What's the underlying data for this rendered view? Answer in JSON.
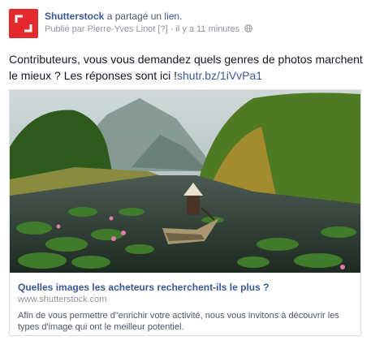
{
  "page": {
    "name": "Shutterstock",
    "action_text": " a partagé un ",
    "story_link": "lien",
    "story_suffix": "."
  },
  "meta": {
    "prefix": "Publié par ",
    "author": "Pierre-Yves Linot",
    "author_badge": " [?] ",
    "separator": "· ",
    "time": "il y a 11 minutes",
    "audience_icon": "globe-icon"
  },
  "message": {
    "text": "Contributeurs, vous vous demandez quels genres de photos marchent le mieux ? Les réponses sont ici !",
    "link": "shutr.bz/1iVvPa1"
  },
  "card": {
    "image_subject": "landscape-photo",
    "title": "Quelles images les acheteurs recherchent-ils le plus ?",
    "domain": "www.shutterstock.com",
    "description": "Afin de vous permettre d\"enrichir votre activité, nous vous invitons à découvrir les types d'image qui ont le meilleur potentiel."
  },
  "colors": {
    "brand_red": "#e42a2e",
    "link_blue": "#3b5998",
    "muted_gray": "#90949c"
  }
}
